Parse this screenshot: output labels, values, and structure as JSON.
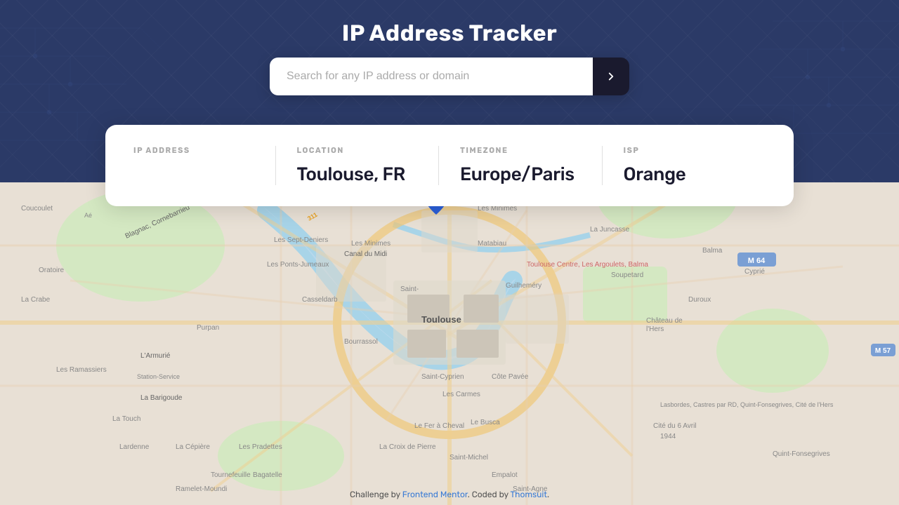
{
  "app": {
    "title": "IP Address Tracker"
  },
  "search": {
    "placeholder": "Search for any IP address or domain",
    "button_label": "Search"
  },
  "info_card": {
    "sections": [
      {
        "label": "IP ADDRESS",
        "value": ""
      },
      {
        "label": "LOCATION",
        "value": "Toulouse, FR"
      },
      {
        "label": "TIMEZONE",
        "value": "Europe/Paris"
      },
      {
        "label": "ISP",
        "value": "Orange"
      }
    ]
  },
  "map": {
    "center_lat": 43.6047,
    "center_lon": 1.4442,
    "city": "Toulouse"
  },
  "footer": {
    "text_before": "Challenge by ",
    "link1_text": "Frontend Mentor",
    "link1_url": "#",
    "text_middle": ". Coded by ",
    "link2_text": "Thomsuit",
    "link2_url": "#",
    "text_after": "."
  },
  "colors": {
    "header_bg": "#2b3a67",
    "search_btn_bg": "#1a1a2e",
    "info_label": "#aaaaaa",
    "info_value": "#1a1a2e",
    "accent": "#3a7bd5"
  }
}
